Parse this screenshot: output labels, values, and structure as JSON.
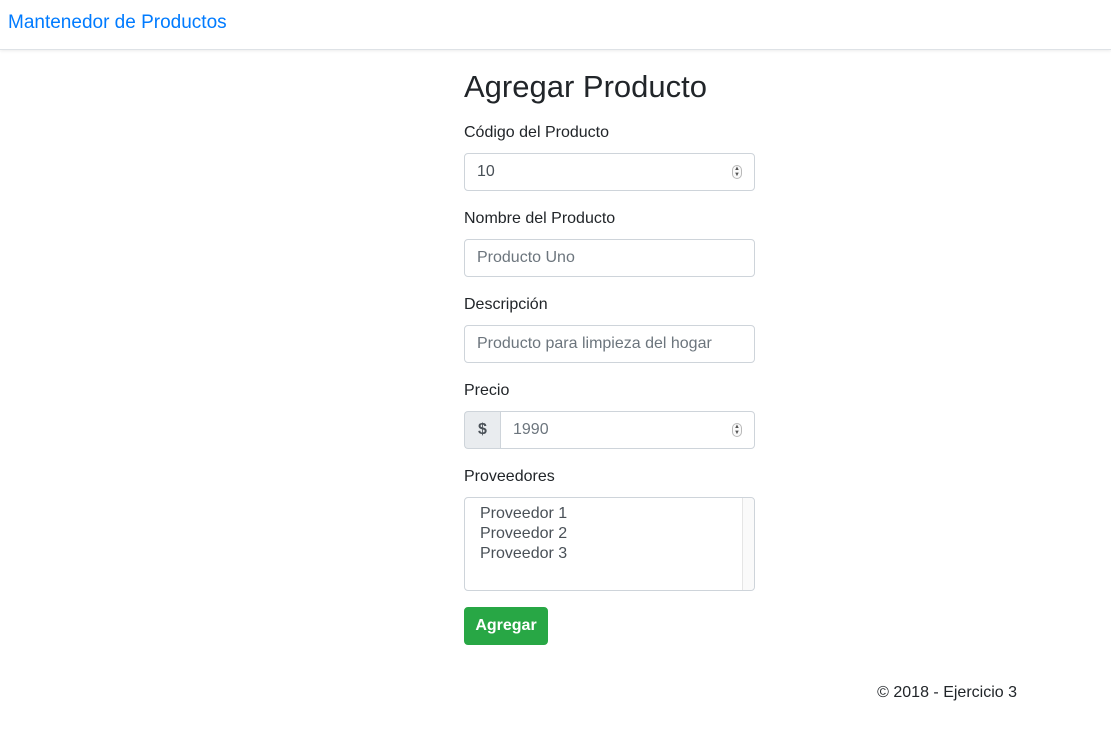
{
  "navbar": {
    "brand": "Mantenedor de Productos"
  },
  "page": {
    "title": "Agregar Producto"
  },
  "form": {
    "codigo": {
      "label": "Código del Producto",
      "value": "10"
    },
    "nombre": {
      "label": "Nombre del Producto",
      "placeholder": "Producto Uno"
    },
    "descripcion": {
      "label": "Descripción",
      "placeholder": "Producto para limpieza del hogar"
    },
    "precio": {
      "label": "Precio",
      "prefix": "$",
      "placeholder": "1990"
    },
    "proveedores": {
      "label": "Proveedores",
      "options": [
        "Proveedor 1",
        "Proveedor 2",
        "Proveedor 3"
      ]
    },
    "submit_label": "Agregar"
  },
  "footer": {
    "text": "© 2018 - Ejercicio 3"
  },
  "colors": {
    "brand": "#007bff",
    "submit": "#28a745"
  }
}
